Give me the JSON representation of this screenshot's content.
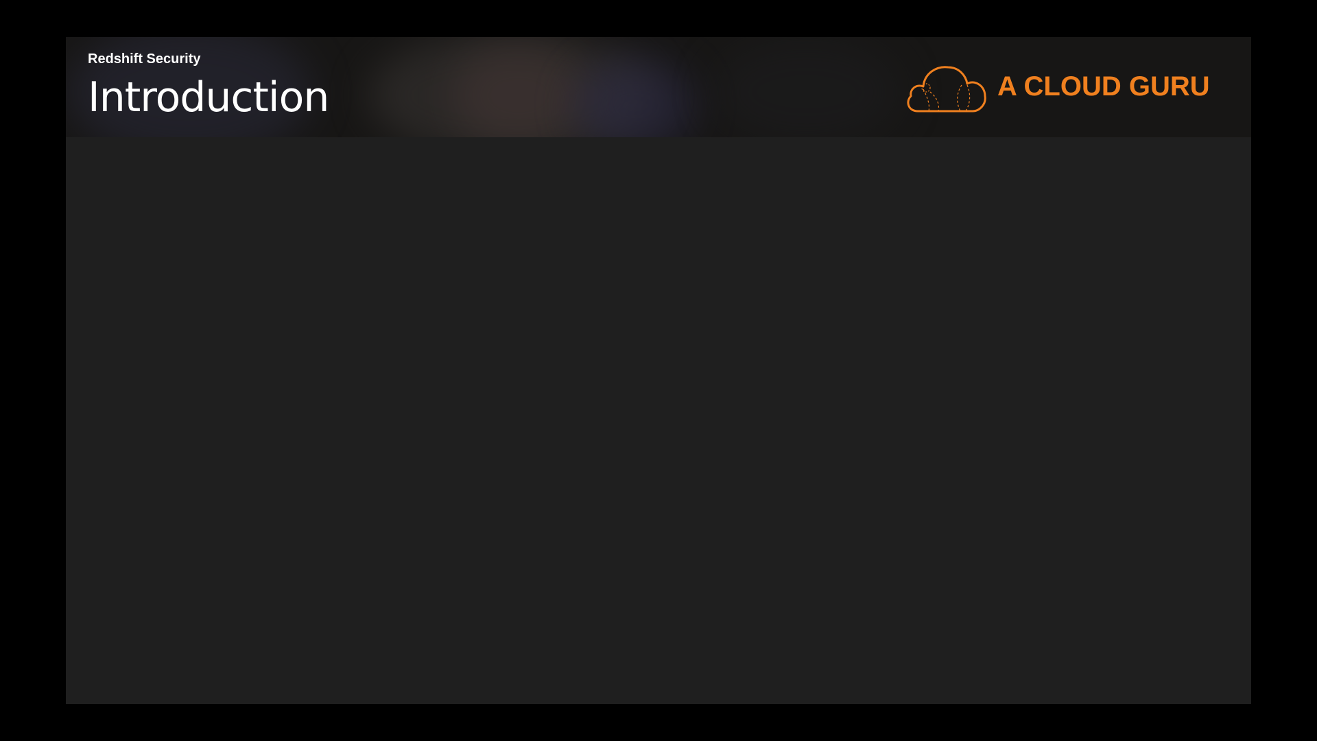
{
  "slide": {
    "subtitle": "Redshift Security",
    "title": "Introduction"
  },
  "logo": {
    "text": "A CLOUD GURU",
    "icon": "cloud-icon",
    "color": "#f0801f"
  },
  "colors": {
    "frame_background": "#000000",
    "slide_background": "#1f1f1f",
    "header_background": "#171615",
    "text": "#ffffff",
    "accent": "#f0801f"
  }
}
